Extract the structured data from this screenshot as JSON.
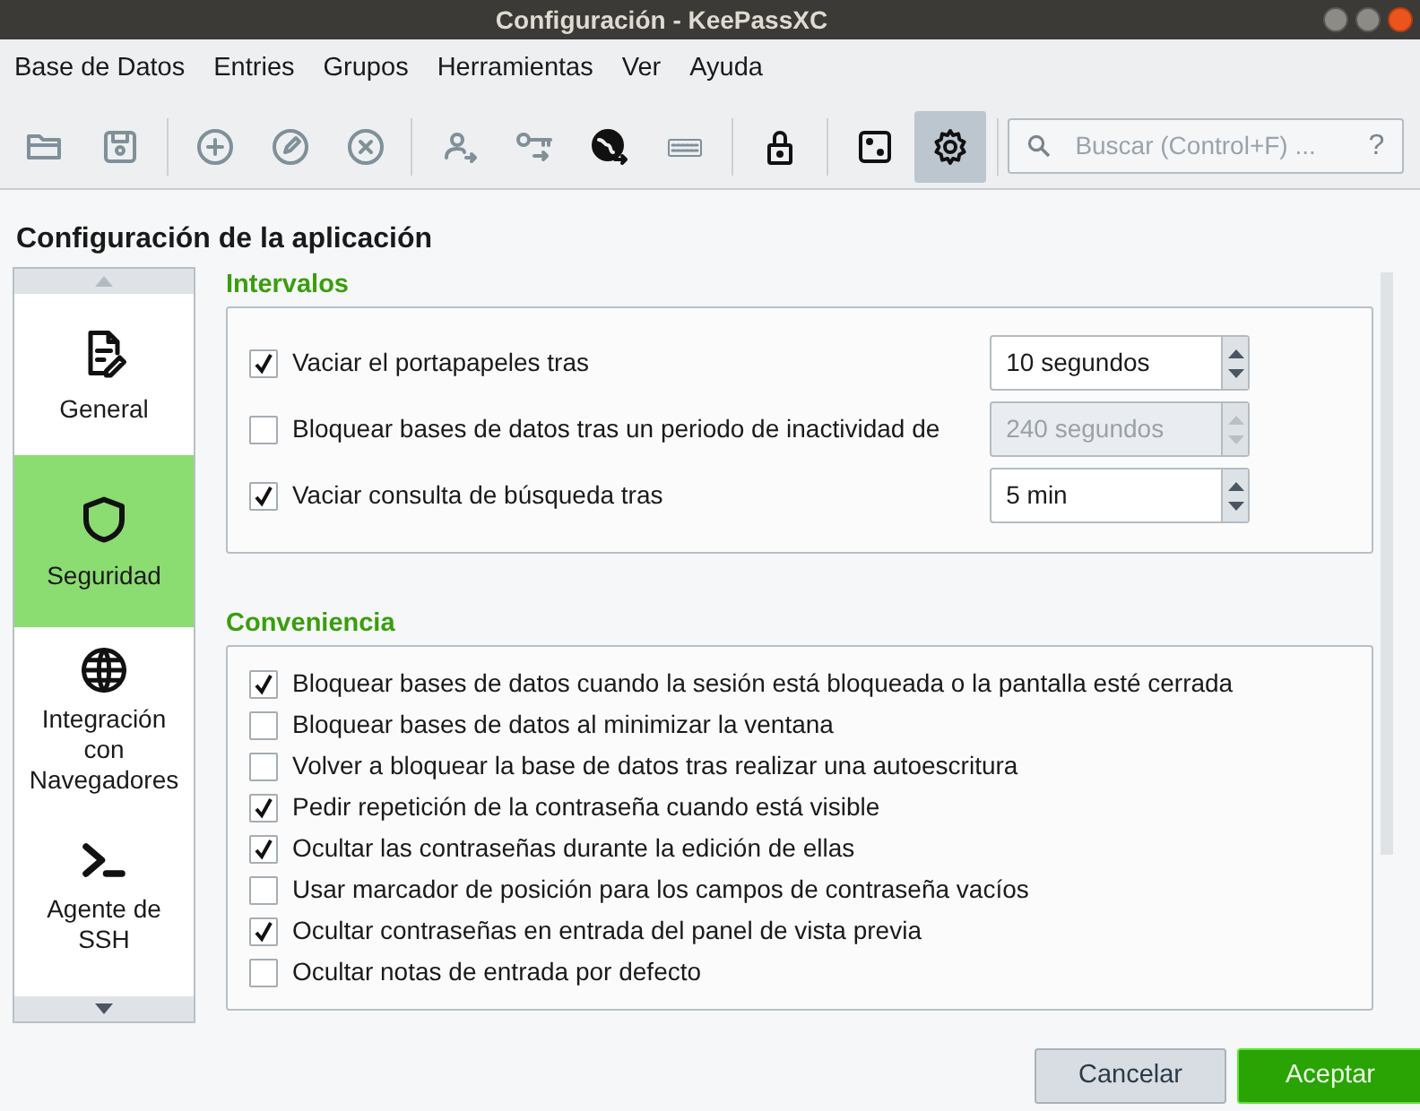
{
  "window": {
    "title": "Configuración - KeePassXC"
  },
  "menu": [
    "Base de Datos",
    "Entries",
    "Grupos",
    "Herramientas",
    "Ver",
    "Ayuda"
  ],
  "toolbar": [
    [
      {
        "kind": "folder",
        "disabled": true,
        "selected": false
      },
      {
        "kind": "save",
        "disabled": true,
        "selected": false
      }
    ],
    [
      {
        "kind": "add",
        "disabled": true,
        "selected": false
      },
      {
        "kind": "edit",
        "disabled": true,
        "selected": false
      },
      {
        "kind": "delete",
        "disabled": true,
        "selected": false
      }
    ],
    [
      {
        "kind": "user",
        "disabled": true,
        "selected": false
      },
      {
        "kind": "key",
        "disabled": true,
        "selected": false
      },
      {
        "kind": "globe",
        "disabled": false,
        "selected": false
      },
      {
        "kind": "keyboard",
        "disabled": true,
        "selected": false
      }
    ],
    [
      {
        "kind": "lock",
        "disabled": false,
        "selected": false
      }
    ],
    [
      {
        "kind": "dice",
        "disabled": false,
        "selected": false
      },
      {
        "kind": "gear",
        "disabled": false,
        "selected": true
      }
    ]
  ],
  "search": {
    "placeholder": "Buscar (Control+F) ...",
    "help": "?"
  },
  "settings_title": "Configuración de la aplicación",
  "sidebar": [
    {
      "label": "General",
      "selected": false
    },
    {
      "label": "Seguridad",
      "selected": true
    },
    {
      "label": "Integración con Navegadores",
      "selected": false
    },
    {
      "label": "Agente de SSH",
      "selected": false
    }
  ],
  "sections": [
    {
      "title": "Intervalos",
      "rows": [
        {
          "kind": "spin",
          "label": "Vaciar el portapapeles tras",
          "checked": true,
          "value": "10 segundos",
          "disabled": false
        },
        {
          "kind": "spin",
          "label": "Bloquear bases de datos tras un periodo de inactividad de",
          "checked": false,
          "value": "240 segundos",
          "disabled": true
        },
        {
          "kind": "spin",
          "label": "Vaciar consulta de búsqueda tras",
          "checked": true,
          "value": "5 min",
          "disabled": false
        }
      ]
    },
    {
      "title": "Conveniencia",
      "rows": [
        {
          "kind": "check",
          "label": "Bloquear bases de datos cuando la sesión está bloqueada o la pantalla esté cerrada",
          "checked": true
        },
        {
          "kind": "check",
          "label": "Bloquear bases de datos al minimizar la ventana",
          "checked": false
        },
        {
          "kind": "check",
          "label": "Volver a bloquear la base de datos tras realizar una autoescritura",
          "checked": false
        },
        {
          "kind": "check",
          "label": "Pedir repetición de la contraseña cuando está visible",
          "checked": true
        },
        {
          "kind": "check",
          "label": "Ocultar las contraseñas durante la edición de ellas",
          "checked": true
        },
        {
          "kind": "check",
          "label": "Usar marcador de posición para los campos de contraseña vacíos",
          "checked": false
        },
        {
          "kind": "check",
          "label": "Ocultar contraseñas en entrada del panel de vista previa",
          "checked": true
        },
        {
          "kind": "check",
          "label": "Ocultar notas de entrada por defecto",
          "checked": false
        }
      ]
    }
  ],
  "buttons": [
    {
      "label": "Cancelar",
      "kind": "secondary"
    },
    {
      "label": "Aceptar",
      "kind": "primary"
    }
  ]
}
